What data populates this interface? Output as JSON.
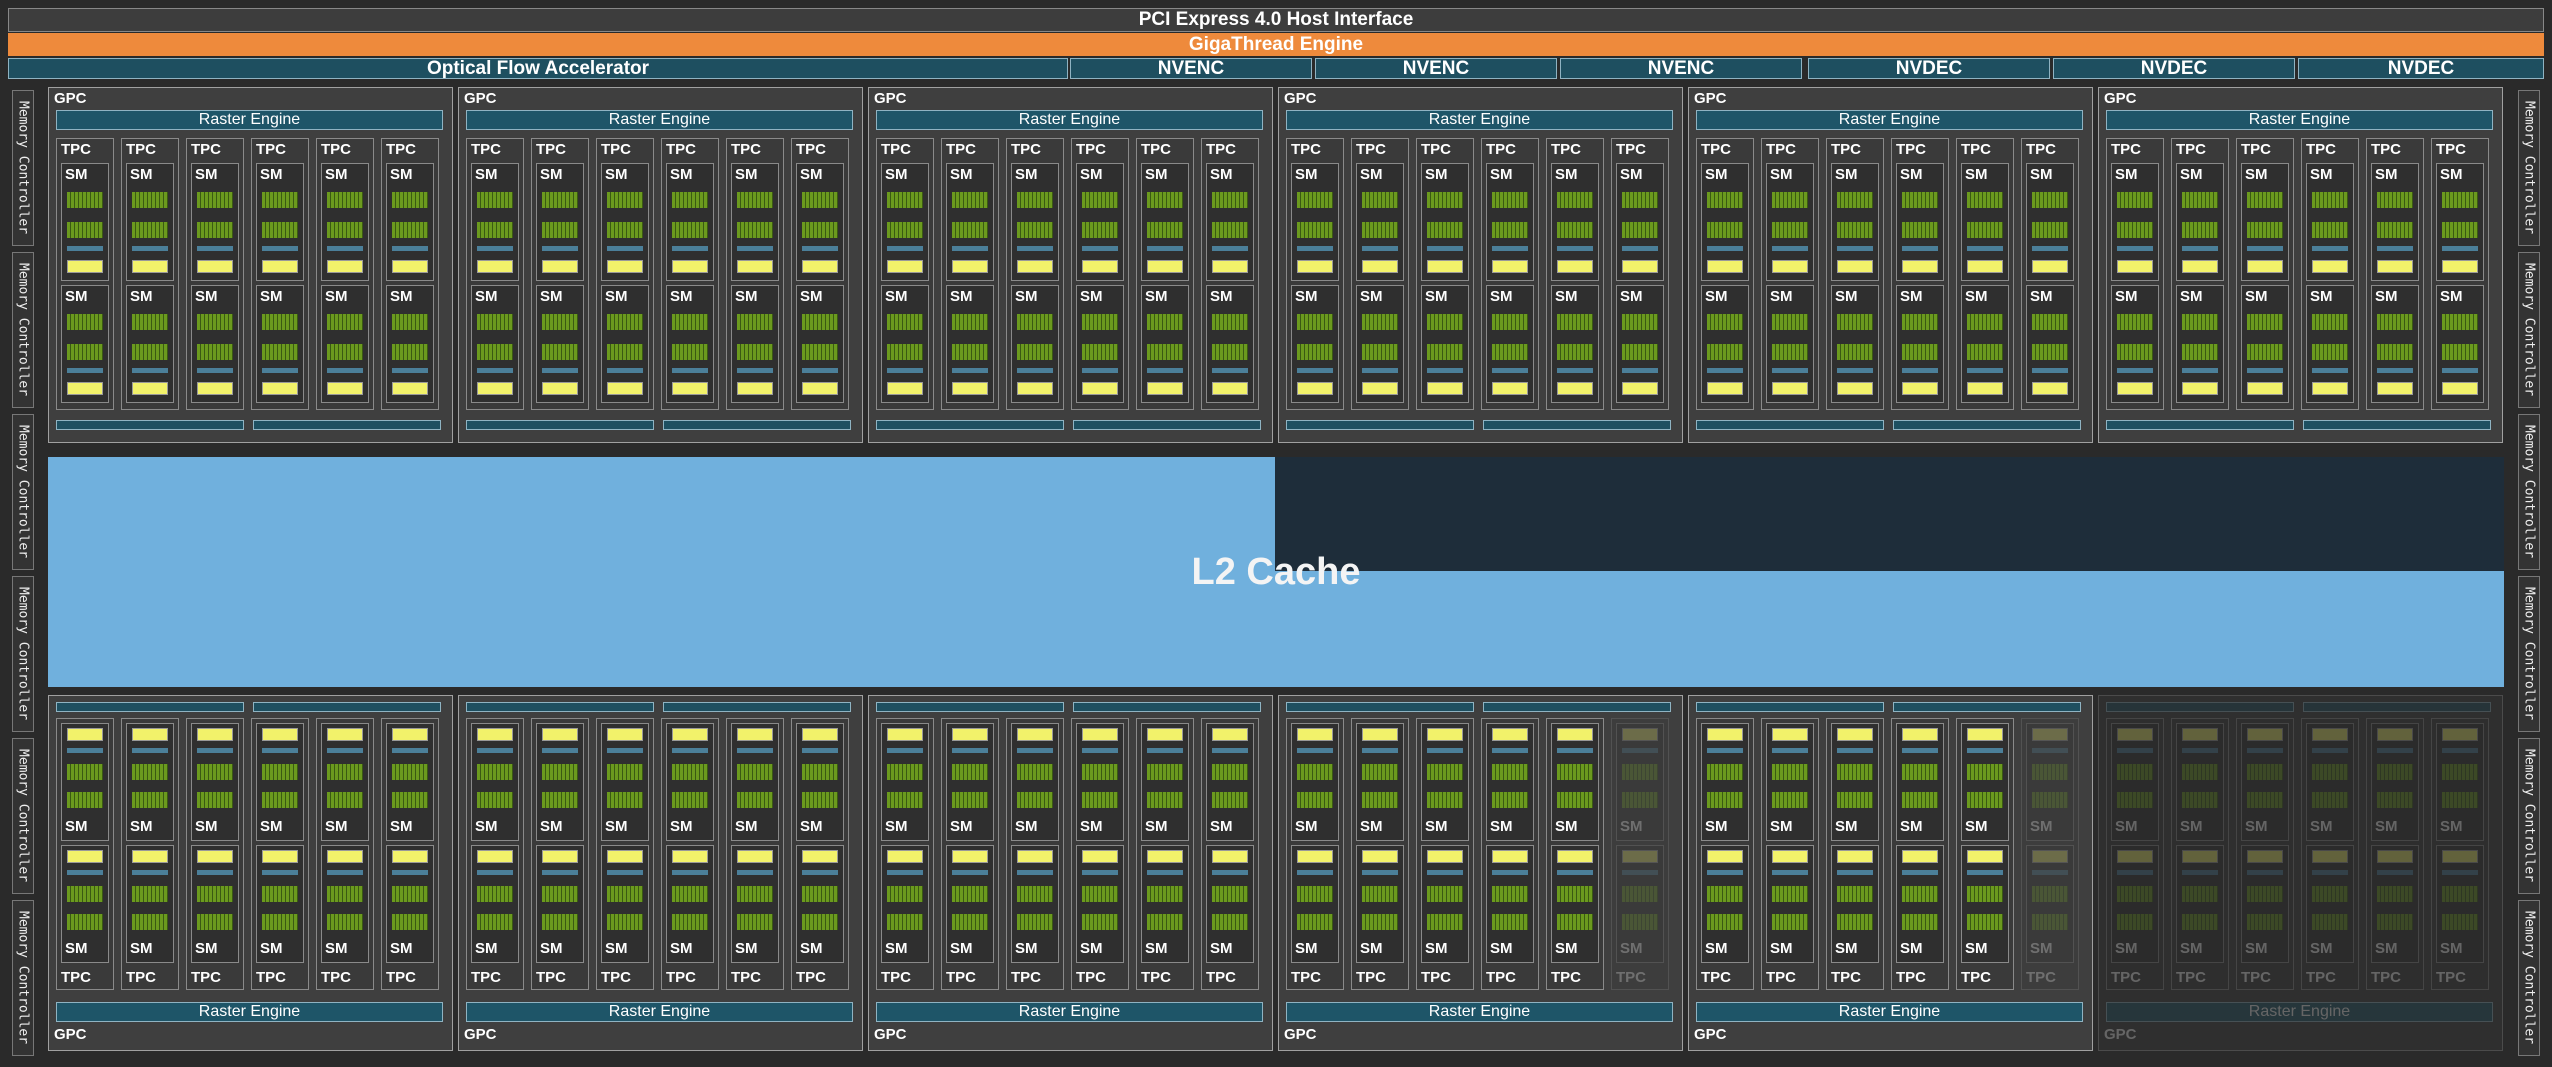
{
  "header": {
    "pcie_label": "PCI Express 4.0 Host Interface",
    "gigathread_label": "GigaThread Engine"
  },
  "accelerators": [
    {
      "label": "Optical Flow Accelerator"
    },
    {
      "label": "NVENC"
    },
    {
      "label": "NVENC"
    },
    {
      "label": "NVENC"
    },
    {
      "label": "NVDEC"
    },
    {
      "label": "NVDEC"
    },
    {
      "label": "NVDEC"
    }
  ],
  "memory_controller_label": "Memory Controller",
  "memory_controllers_per_side": 6,
  "l2_cache_label": "L2 Cache",
  "gpc": {
    "label": "GPC",
    "raster_label": "Raster Engine",
    "tpc_label": "TPC",
    "sm_label": "SM",
    "tpcs_per_gpc": 6,
    "sms_per_tpc": 2
  },
  "gpcs_top": [
    {
      "enabled": true,
      "disabled_tpcs": []
    },
    {
      "enabled": true,
      "disabled_tpcs": []
    },
    {
      "enabled": true,
      "disabled_tpcs": []
    },
    {
      "enabled": true,
      "disabled_tpcs": []
    },
    {
      "enabled": true,
      "disabled_tpcs": []
    },
    {
      "enabled": true,
      "disabled_tpcs": []
    }
  ],
  "gpcs_bottom": [
    {
      "enabled": true,
      "disabled_tpcs": []
    },
    {
      "enabled": true,
      "disabled_tpcs": []
    },
    {
      "enabled": true,
      "disabled_tpcs": []
    },
    {
      "enabled": true,
      "disabled_tpcs": [
        5
      ]
    },
    {
      "enabled": true,
      "disabled_tpcs": [
        5
      ]
    },
    {
      "enabled": false,
      "disabled_tpcs": [
        0,
        1,
        2,
        3,
        4,
        5
      ]
    }
  ],
  "colors": {
    "gigathread": "#ee8a3c",
    "raster": "#1e5568",
    "l2_cache": "#70b0dd",
    "sm_green": "#6b9a1e",
    "sm_yellow": "#f2f26a"
  }
}
